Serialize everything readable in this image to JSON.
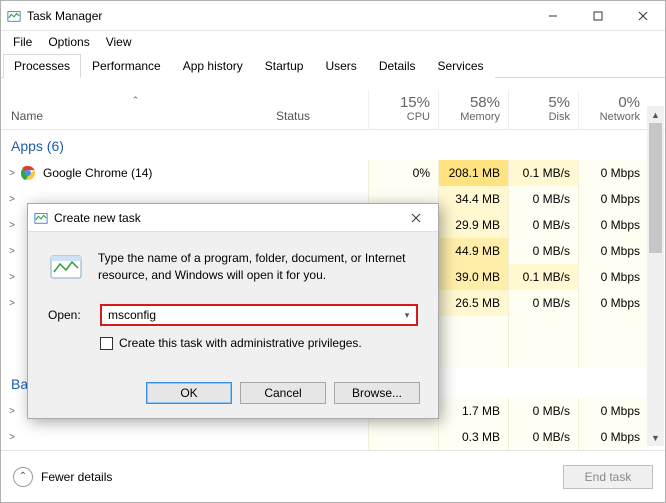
{
  "window": {
    "title": "Task Manager",
    "minimize": "Minimize",
    "maximize": "Maximize",
    "close": "Close"
  },
  "menu": {
    "file": "File",
    "options": "Options",
    "view": "View"
  },
  "tabs": [
    {
      "label": "Processes",
      "active": true
    },
    {
      "label": "Performance",
      "active": false
    },
    {
      "label": "App history",
      "active": false
    },
    {
      "label": "Startup",
      "active": false
    },
    {
      "label": "Users",
      "active": false
    },
    {
      "label": "Details",
      "active": false
    },
    {
      "label": "Services",
      "active": false
    }
  ],
  "columns": {
    "name": "Name",
    "status": "Status",
    "cpu": {
      "pct": "15%",
      "label": "CPU"
    },
    "memory": {
      "pct": "58%",
      "label": "Memory"
    },
    "disk": {
      "pct": "5%",
      "label": "Disk"
    },
    "network": {
      "pct": "0%",
      "label": "Network"
    }
  },
  "group_apps": "Apps (6)",
  "group_background_prefix": "Ba",
  "rows": [
    {
      "name": "Google Chrome (14)",
      "cpu": "0%",
      "mem": "208.1 MB",
      "disk": "0.1 MB/s",
      "net": "0 Mbps",
      "expandable": true,
      "icon": "chrome",
      "heat": {
        "cpu": 0,
        "mem": 3,
        "disk": 1,
        "net": 0
      }
    },
    {
      "name": "",
      "cpu": "",
      "mem": "34.4 MB",
      "disk": "0 MB/s",
      "net": "0 Mbps",
      "expandable": true,
      "heat": {
        "cpu": 0,
        "mem": 1,
        "disk": 0,
        "net": 0
      }
    },
    {
      "name": "",
      "cpu": "",
      "mem": "29.9 MB",
      "disk": "0 MB/s",
      "net": "0 Mbps",
      "expandable": true,
      "heat": {
        "cpu": 0,
        "mem": 1,
        "disk": 0,
        "net": 0
      }
    },
    {
      "name": "",
      "cpu": "",
      "mem": "44.9 MB",
      "disk": "0 MB/s",
      "net": "0 Mbps",
      "expandable": true,
      "heat": {
        "cpu": 0,
        "mem": 2,
        "disk": 0,
        "net": 0
      }
    },
    {
      "name": "",
      "cpu": "",
      "mem": "39.0 MB",
      "disk": "0.1 MB/s",
      "net": "0 Mbps",
      "expandable": true,
      "heat": {
        "cpu": 0,
        "mem": 2,
        "disk": 1,
        "net": 0
      }
    },
    {
      "name": "",
      "cpu": "",
      "mem": "26.5 MB",
      "disk": "0 MB/s",
      "net": "0 Mbps",
      "expandable": true,
      "heat": {
        "cpu": 0,
        "mem": 1,
        "disk": 0,
        "net": 0
      }
    },
    {
      "name": "",
      "cpu": "",
      "mem": "",
      "disk": "",
      "net": "",
      "expandable": false,
      "blank": true
    },
    {
      "name": "",
      "cpu": "",
      "mem": "",
      "disk": "",
      "net": "",
      "expandable": false,
      "blank": true
    },
    {
      "name": "",
      "cpu": "",
      "mem": "1.7 MB",
      "disk": "0 MB/s",
      "net": "0 Mbps",
      "expandable": true,
      "heat": {
        "cpu": 0,
        "mem": 0,
        "disk": 0,
        "net": 0
      }
    },
    {
      "name": "",
      "cpu": "",
      "mem": "0.3 MB",
      "disk": "0 MB/s",
      "net": "0 Mbps",
      "expandable": true,
      "heat": {
        "cpu": 0,
        "mem": 0,
        "disk": 0,
        "net": 0
      }
    }
  ],
  "footer": {
    "fewer": "Fewer details",
    "endtask": "End task"
  },
  "dialog": {
    "title": "Create new task",
    "message": "Type the name of a program, folder, document, or Internet resource, and Windows will open it for you.",
    "open_label": "Open:",
    "input_value": "msconfig",
    "admin_label": "Create this task with administrative privileges.",
    "admin_checked": false,
    "buttons": {
      "ok": "OK",
      "cancel": "Cancel",
      "browse": "Browse..."
    }
  }
}
